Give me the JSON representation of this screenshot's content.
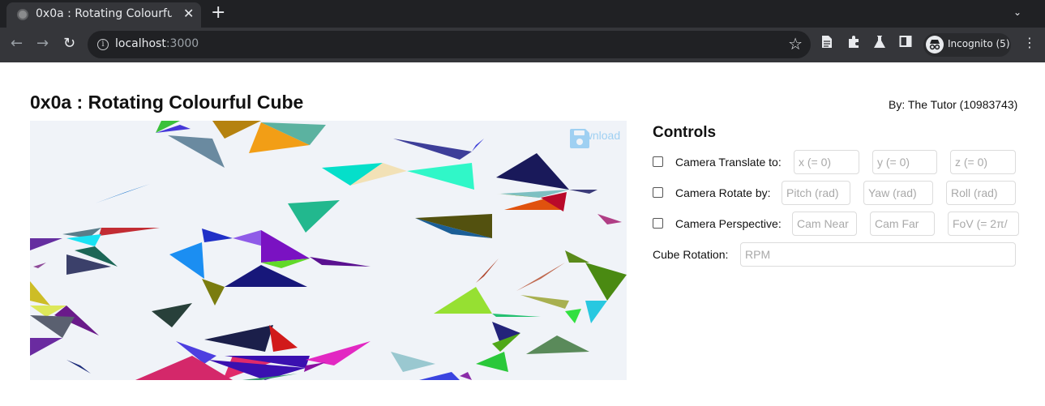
{
  "browser": {
    "tab_title": "0x0a : Rotating Colourful Cube",
    "url_host": "localhost",
    "url_port": ":3000",
    "profile_label": "Incognito (5)"
  },
  "page": {
    "title": "0x0a : Rotating Colourful Cube",
    "byline": "By: The Tutor (10983743)"
  },
  "canvas": {
    "download_label": "Download",
    "background": "#f0f3f8"
  },
  "controls": {
    "heading": "Controls",
    "translate": {
      "label": "Camera Translate to:",
      "x_placeholder": "x (= 0)",
      "y_placeholder": "y (= 0)",
      "z_placeholder": "z (= 0)"
    },
    "rotate": {
      "label": "Camera Rotate by:",
      "pitch_placeholder": "Pitch (rad)",
      "yaw_placeholder": "Yaw (rad)",
      "roll_placeholder": "Roll (rad)"
    },
    "perspective": {
      "label": "Camera Perspective:",
      "near_placeholder": "Cam Near",
      "far_placeholder": "Cam Far",
      "fov_placeholder": "FoV (= 2π/"
    },
    "cube_rotation": {
      "label": "Cube Rotation:",
      "placeholder": "RPM"
    }
  },
  "icons": {
    "favicon": "globe-icon",
    "close": "close-icon",
    "new_tab": "plus-icon",
    "tab_search": "chevron-down-icon",
    "back": "arrow-left-icon",
    "forward": "arrow-right-icon",
    "reload": "reload-icon",
    "site_info": "info-icon",
    "bookmark": "star-icon",
    "reader": "document-icon",
    "extensions": "puzzle-icon",
    "labs": "flask-icon",
    "side_panel": "side-panel-icon",
    "incognito": "incognito-icon",
    "menu": "kebab-menu-icon",
    "download": "floppy-disk-icon"
  }
}
